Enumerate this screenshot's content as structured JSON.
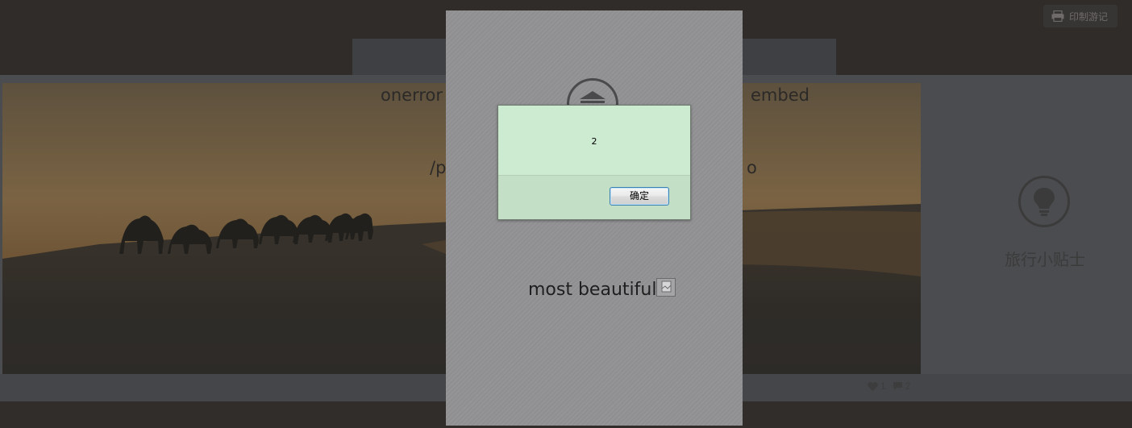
{
  "background": {
    "print_button": {
      "label": "印制游记",
      "icon": "printer-icon"
    },
    "overlay_left": "onerror",
    "overlay_right": "embed",
    "overlay_left2": "/p",
    "overlay_right2": "o",
    "tips": {
      "label": "旅行小贴士",
      "icon": "lightbulb-icon"
    },
    "like_count": "1",
    "comment_count": "2"
  },
  "panel": {
    "icon": "museum-icon",
    "text": "most beautiful",
    "image": "broken-image-icon"
  },
  "alert": {
    "message": "2",
    "ok_label": "确定"
  }
}
